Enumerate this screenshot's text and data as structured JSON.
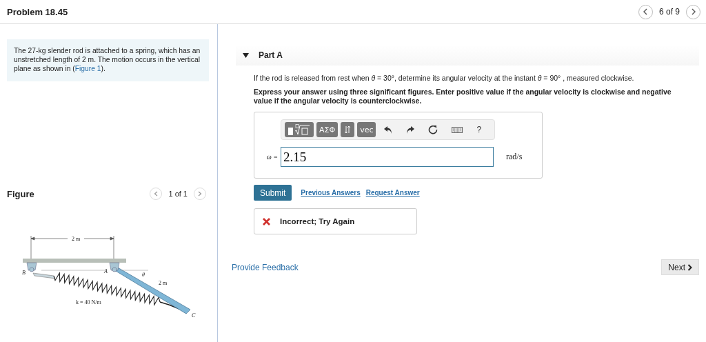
{
  "header": {
    "title": "Problem 18.45",
    "pager": "6 of 9"
  },
  "problem": {
    "before": "The 27-kg slender rod is attached to a spring, which has an unstretched length of 2 m. The motion occurs in the vertical plane as shown in (",
    "link": "Figure 1",
    "after": ")."
  },
  "figure": {
    "title": "Figure",
    "pager": "1 of 1",
    "labels": {
      "width": "2 m",
      "b": "B",
      "a": "A",
      "theta": "θ",
      "length": "2 m",
      "k": "k = 40 N/m",
      "c": "C"
    }
  },
  "part": {
    "title": "Part A",
    "expanded": true,
    "question": "If the rod is released from rest when *θ* = 30°, determine its angular velocity at the instant *θ* = 90° , measured clockwise.",
    "instruction": "Express your answer using three significant figures. Enter positive value if the angular velocity is clockwise and negative value if the angular velocity is counterclockwise.",
    "toolbar": [
      {
        "kind": "template"
      },
      {
        "kind": "label",
        "text": "ΑΣΦ"
      },
      {
        "kind": "arrows"
      },
      {
        "kind": "label",
        "text": "vec"
      },
      {
        "kind": "undo"
      },
      {
        "kind": "redo"
      },
      {
        "kind": "reset"
      },
      {
        "kind": "keyboard"
      },
      {
        "kind": "help",
        "text": "?"
      }
    ],
    "variable": "ω =",
    "answer": "2.15",
    "unit": "rad/s"
  },
  "actions": {
    "submit": "Submit",
    "links": [
      "Previous Answers",
      "Request Answer"
    ]
  },
  "feedback": {
    "correct": false,
    "text": "Incorrect; Try Again"
  },
  "footer": {
    "link": "Provide Feedback",
    "next": "Next"
  }
}
